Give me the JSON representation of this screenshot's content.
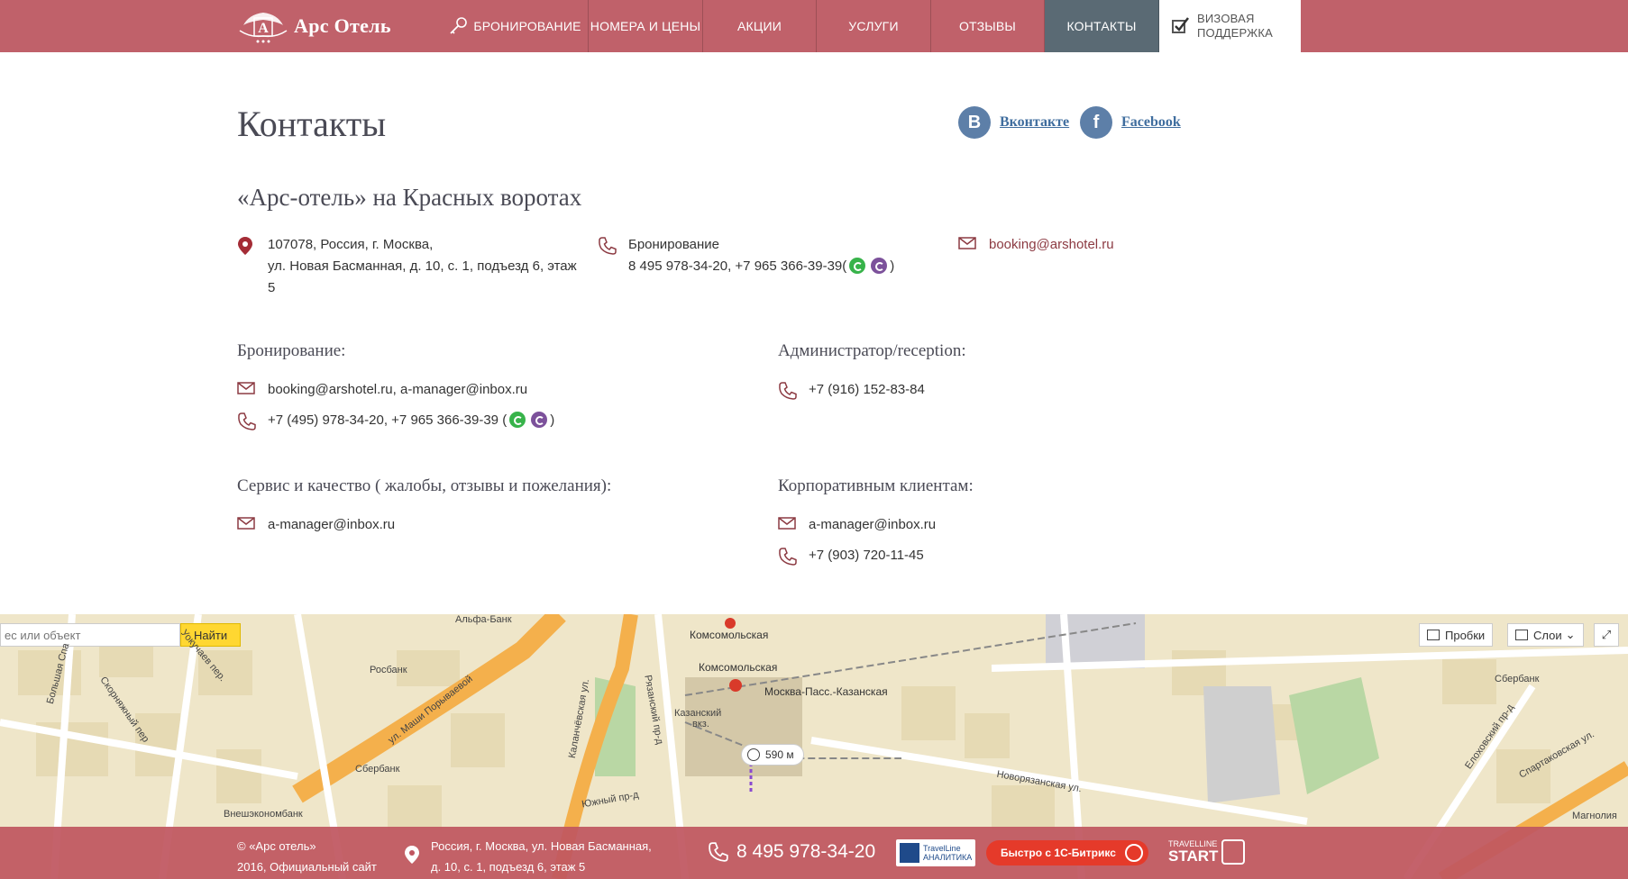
{
  "header": {
    "logo_text": "Арс Отель",
    "nav": [
      {
        "label": "Бронирование"
      },
      {
        "label": "Номера и цены"
      },
      {
        "label": "Акции"
      },
      {
        "label": "Услуги"
      },
      {
        "label": "Отзывы"
      },
      {
        "label": "Контакты",
        "active": true
      }
    ],
    "visa_line1": "Визовая",
    "visa_line2": "поддержка"
  },
  "colors": {
    "header_bg": "#c0616a",
    "active_nav": "#5a6a74",
    "icon_red": "#8c3a42",
    "social_blue": "#5d7fa8",
    "link_blue": "#3f6d9e"
  },
  "page_title": "Контакты",
  "social": {
    "vk_label": "Вконтакте",
    "vk_letter": "B",
    "fb_label": "Facebook",
    "fb_letter": "f"
  },
  "hotel_name": "«Арс-отель» на Красных воротах",
  "address": {
    "line1": "107078, Россия, г. Москва,",
    "line2": "ул. Новая Басманная, д. 10, с. 1, подъезд 6, этаж",
    "line3": "5"
  },
  "booking_phone": {
    "label": "Бронирование",
    "phones": "8 495 978-34-20, +7 965 366-39-39(",
    "close": ")"
  },
  "top_email": "booking@arshotel.ru",
  "sections": {
    "booking": {
      "title": "Бронирование:",
      "email": "booking@arshotel.ru, a-manager@inbox.ru",
      "phone": "+7 (495) 978-34-20, +7 965 366-39-39 (",
      "close": ")"
    },
    "admin": {
      "title": "Администратор/reception:",
      "phone": "+7 (916) 152-83-84"
    },
    "service": {
      "title": "Сервис и качество ( жалобы, отзывы и пожелания):",
      "email": "a-manager@inbox.ru"
    },
    "corporate": {
      "title": "Корпоративным клиентам:",
      "email": "a-manager@inbox.ru",
      "phone": "+7 (903) 720-11-45"
    }
  },
  "map": {
    "search_placeholder": "ес или объект",
    "search_button": "Найти",
    "traffic": "Пробки",
    "layers": "Слои",
    "route_distance": "590 м",
    "labels": {
      "komsomolskaya_top": "Комсомольская",
      "komsomolskaya": "Комсомольская",
      "moscow_pass": "Москва-Пасс.-Казанская",
      "kazansky": "Казанский",
      "vokz": "вкз.",
      "sberbank1": "Сбербанк",
      "sberbank2": "Сбербанк",
      "rosbank": "Росбанк",
      "alfabank": "Альфа-Банк",
      "vneshekonombank": "Внешэкономбанк",
      "porivaevoy": "ул. Маши Порываевой",
      "kalanchevskaya": "Каланчёвская ул.",
      "ryazansky": "Рязанский пр-д",
      "yuzhny": "Южный пр-д",
      "novoryazanskaya": "Новорязанская ул.",
      "spartakovskaya": "Спартаковская ул.",
      "skornyazhny": "Скорняжный пер",
      "bolshaya_spa": "Большая Спа",
      "yokichaev": "Уокучаев пер.",
      "magnolia": "Магнолия",
      "lokhovsky": "Елоховский пр-д"
    }
  },
  "footer": {
    "copy_line1": "© «Арс отель»",
    "copy_line2": "2016, Официальный сайт",
    "addr_line1": "Россия, г. Москва, ул. Новая Басманная,",
    "addr_line2": "д. 10, с. 1, подъезд 6, этаж 5",
    "phone": "8 495 978-34-20",
    "tl_line1": "TravelLine",
    "tl_line2": "АНАЛИТИКА",
    "bitrix": "Быстро с 1С-Битрикс",
    "tl_start_line1": "TRAVELLINE",
    "tl_start_line2": "START"
  }
}
